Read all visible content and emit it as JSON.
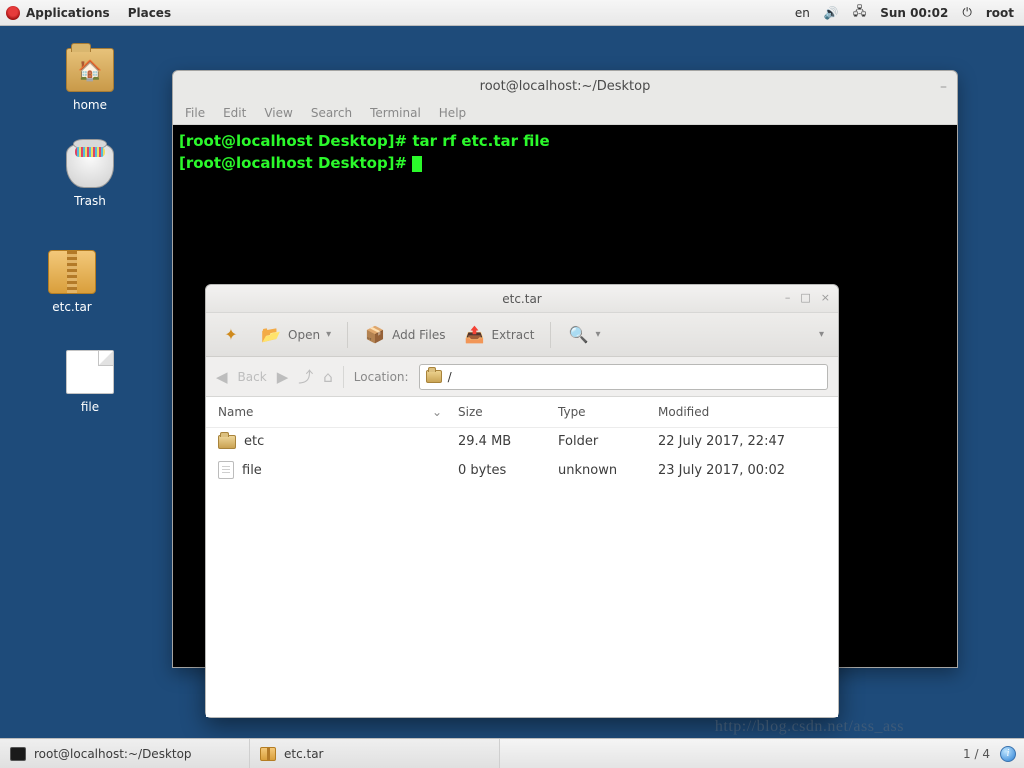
{
  "panel": {
    "applications": "Applications",
    "places": "Places",
    "lang": "en",
    "clock": "Sun 00:02",
    "user": "root"
  },
  "desktop": {
    "home": "home",
    "trash": "Trash",
    "archive": "etc.tar",
    "file": "file"
  },
  "terminal": {
    "title": "root@localhost:~/Desktop",
    "menu": {
      "file": "File",
      "edit": "Edit",
      "view": "View",
      "search": "Search",
      "terminal": "Terminal",
      "help": "Help"
    },
    "prompt": "[root@localhost Desktop]#",
    "cmd": "tar rf etc.tar file"
  },
  "archive": {
    "title": "etc.tar",
    "toolbar": {
      "open": "Open",
      "addfiles": "Add Files",
      "extract": "Extract"
    },
    "nav": {
      "back": "Back",
      "location_label": "Location:",
      "location_value": "/"
    },
    "columns": {
      "name": "Name",
      "size": "Size",
      "type": "Type",
      "modified": "Modified"
    },
    "rows": [
      {
        "name": "etc",
        "kind": "folder",
        "size": "29.4 MB",
        "type": "Folder",
        "modified": "22 July 2017, 22:47"
      },
      {
        "name": "file",
        "kind": "file",
        "size": "0 bytes",
        "type": "unknown",
        "modified": "23 July 2017, 00:02"
      }
    ]
  },
  "taskbar": {
    "task_terminal": "root@localhost:~/Desktop",
    "task_archive": "etc.tar",
    "workspace": "1 / 4"
  },
  "watermark": "http://blog.csdn.net/ass_ass"
}
